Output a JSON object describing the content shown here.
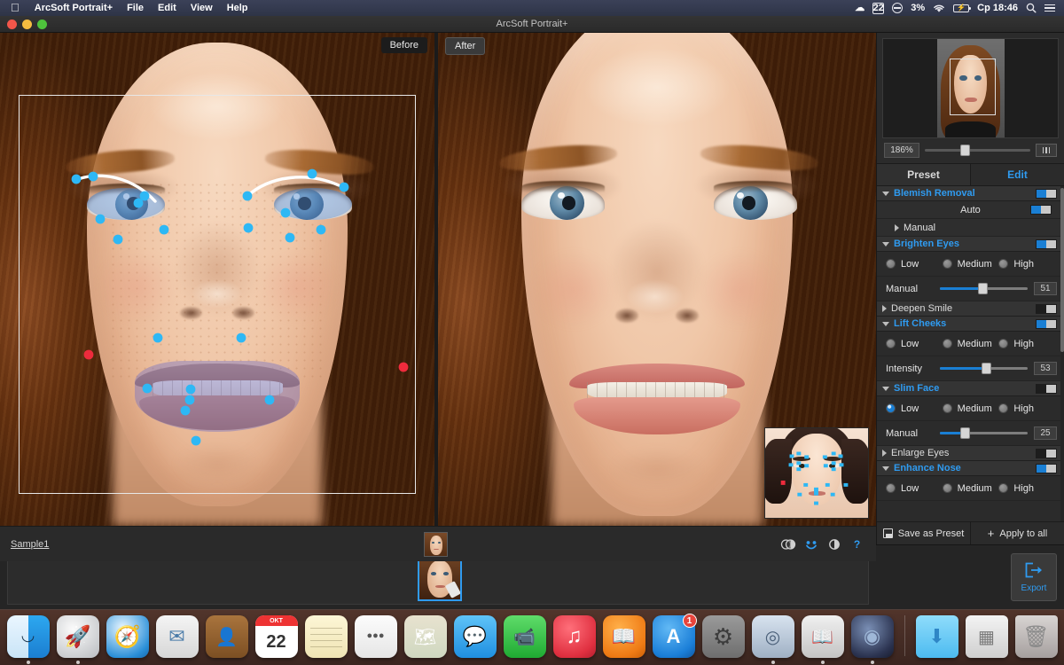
{
  "menubar": {
    "apple_icon": "apple-logo",
    "app_name": "ArcSoft Portrait+",
    "menus": [
      "File",
      "Edit",
      "View",
      "Help"
    ],
    "right": {
      "cloud_icon": "cloud-icon",
      "calendar_icon_label": "22",
      "dnd_icon": "do-not-disturb-icon",
      "battery_percent": "3%",
      "wifi_icon": "wifi-icon",
      "battery_icon": "battery-charging-icon",
      "clock": "Cp 18:46",
      "search_icon": "search-icon",
      "list_icon": "notification-center-icon"
    }
  },
  "window": {
    "title": "ArcSoft Portrait+"
  },
  "workspace": {
    "before_label": "Before",
    "after_label": "After"
  },
  "statusbar": {
    "filename": "Sample1",
    "icons": [
      {
        "name": "compare-toggle-icon",
        "glyph": "◍"
      },
      {
        "name": "face-points-icon",
        "glyph": "☻"
      },
      {
        "name": "reset-icon",
        "glyph": "◑"
      },
      {
        "name": "help-icon",
        "glyph": "?"
      }
    ]
  },
  "sidebar": {
    "zoom": {
      "value": "186%",
      "fit_button_label": "fit-to-window"
    },
    "tabs": [
      {
        "label": "Preset",
        "active": false
      },
      {
        "label": "Edit",
        "active": true
      }
    ],
    "sections": [
      {
        "title": "Blemish Removal",
        "expanded": true,
        "highlighted": true,
        "toggle_on": true,
        "rows": [
          {
            "type": "sub",
            "label": "Auto",
            "centered": true,
            "toggle_on": true
          },
          {
            "type": "sub",
            "label": "Manual",
            "centered": false,
            "arrow": "right"
          }
        ]
      },
      {
        "title": "Brighten Eyes",
        "expanded": true,
        "highlighted": true,
        "toggle_on": true,
        "radios": [
          "Low",
          "Medium",
          "High"
        ],
        "radio_selected": -1,
        "slider": {
          "label": "Manual",
          "value": "51",
          "percent": 46
        }
      },
      {
        "title": "Deepen Smile",
        "expanded": false,
        "highlighted": false,
        "toggle_on": false
      },
      {
        "title": "Lift Cheeks",
        "expanded": true,
        "highlighted": true,
        "toggle_on": true,
        "radios": [
          "Low",
          "Medium",
          "High"
        ],
        "radio_selected": -1,
        "slider": {
          "label": "Intensity",
          "value": "53",
          "percent": 50
        }
      },
      {
        "title": "Slim Face",
        "expanded": true,
        "highlighted": true,
        "toggle_on": false,
        "radios": [
          "Low",
          "Medium",
          "High"
        ],
        "radio_selected": 0,
        "slider": {
          "label": "Manual",
          "value": "25",
          "percent": 26
        }
      },
      {
        "title": "Enlarge Eyes",
        "expanded": false,
        "highlighted": false,
        "toggle_on": false
      },
      {
        "title": "Enhance Nose",
        "expanded": true,
        "highlighted": true,
        "toggle_on": true,
        "radios": [
          "Low",
          "Medium",
          "High"
        ],
        "radio_selected": -1
      }
    ],
    "actions": {
      "save_preset": "Save as Preset",
      "apply_to_all": "Apply to all"
    }
  },
  "filmstrip": {
    "export_label": "Export"
  },
  "dock": {
    "items": [
      {
        "name": "finder",
        "cls": "ic-finder",
        "running": true
      },
      {
        "name": "launchpad",
        "cls": "ic-launchpad",
        "glyph": "🚀",
        "running": true
      },
      {
        "name": "safari",
        "cls": "ic-safari",
        "glyph": "🧭",
        "running": false
      },
      {
        "name": "mail",
        "cls": "ic-mail",
        "glyph": "✉",
        "running": false
      },
      {
        "name": "contacts",
        "cls": "ic-contacts",
        "glyph": "👤",
        "running": false
      },
      {
        "name": "calendar",
        "cls": "ic-calendar",
        "cal_month": "OKT",
        "cal_day": "22",
        "running": false
      },
      {
        "name": "notes",
        "cls": "ic-notes",
        "running": false
      },
      {
        "name": "reminders",
        "cls": "ic-reminders",
        "glyph": "☑",
        "running": false
      },
      {
        "name": "maps",
        "cls": "ic-maps",
        "glyph": "🗺",
        "running": false
      },
      {
        "name": "messages",
        "cls": "ic-messages",
        "glyph": "💬",
        "running": false
      },
      {
        "name": "facetime",
        "cls": "ic-facetime",
        "glyph": "📹",
        "running": false
      },
      {
        "name": "itunes",
        "cls": "ic-itunes",
        "glyph": "♫",
        "running": false
      },
      {
        "name": "ibooks",
        "cls": "ic-ibooks",
        "glyph": "📖",
        "running": false
      },
      {
        "name": "app-store",
        "cls": "ic-appstore",
        "glyph": "A",
        "badge": "1",
        "running": false
      },
      {
        "name": "system-preferences",
        "cls": "ic-sysprefs",
        "glyph": "⚙",
        "running": false
      },
      {
        "name": "dashboard",
        "cls": "ic-dashboard",
        "glyph": "◔",
        "running": true
      },
      {
        "name": "dictionary",
        "cls": "ic-dictionary",
        "glyph": "📖",
        "running": true
      },
      {
        "name": "preview",
        "cls": "ic-preview",
        "glyph": "◉",
        "running": true
      },
      {
        "sep": true
      },
      {
        "name": "downloads-folder",
        "cls": "ic-downloads",
        "glyph": "⬇",
        "running": false
      },
      {
        "name": "documents-stack",
        "cls": "ic-docs",
        "glyph": "▤",
        "running": false
      },
      {
        "name": "trash",
        "cls": "ic-trash",
        "glyph": "🗑",
        "running": false
      }
    ]
  }
}
